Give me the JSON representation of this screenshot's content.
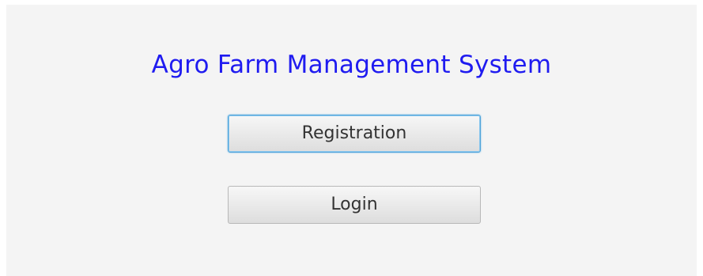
{
  "app": {
    "title": "Agro Farm Management System"
  },
  "buttons": {
    "registration_label": "Registration",
    "login_label": "Login"
  },
  "colors": {
    "title": "#1f1bf0",
    "background": "#f4f4f4",
    "focus_ring": "#4fa3d9"
  }
}
